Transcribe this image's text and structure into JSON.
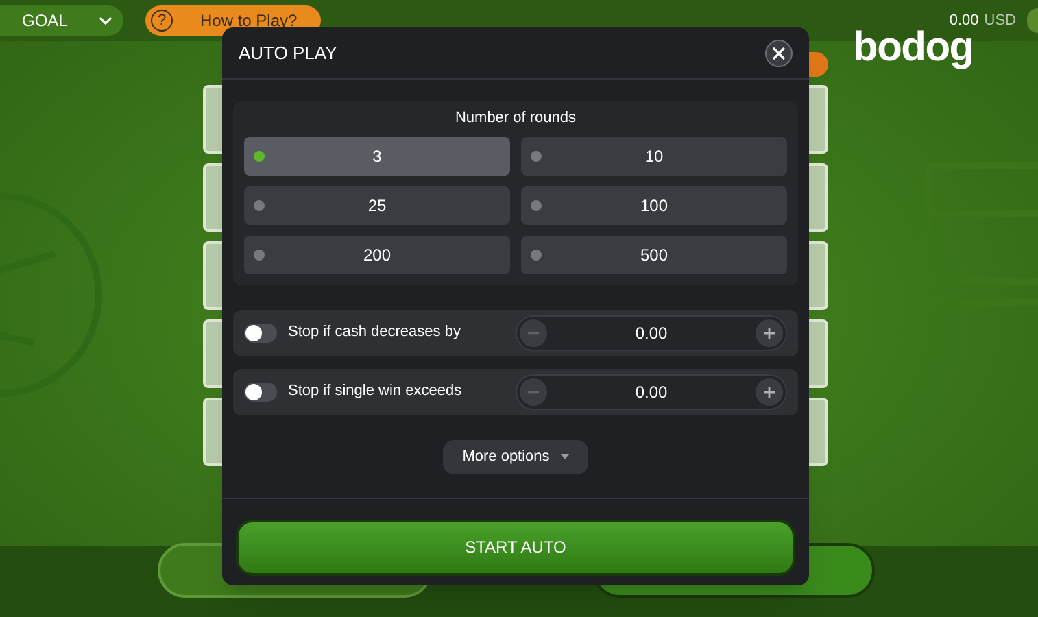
{
  "top_bar": {
    "game_select": "GOAL",
    "help_icon": "?",
    "help_button": "How to Play?",
    "balance": "0.00",
    "currency": "USD",
    "logo": "bodog"
  },
  "modal": {
    "title": "AUTO PLAY",
    "rounds_label": "Number of rounds",
    "rounds": [
      {
        "label": "3",
        "selected": true
      },
      {
        "label": "10",
        "selected": false
      },
      {
        "label": "25",
        "selected": false
      },
      {
        "label": "100",
        "selected": false
      },
      {
        "label": "200",
        "selected": false
      },
      {
        "label": "500",
        "selected": false
      }
    ],
    "stop_conditions": [
      {
        "label": "Stop if cash decreases by",
        "on": false,
        "value": "0.00"
      },
      {
        "label": "Stop if single win exceeds",
        "on": false,
        "value": "0.00"
      }
    ],
    "more_options": "More options",
    "start_button": "START AUTO"
  }
}
